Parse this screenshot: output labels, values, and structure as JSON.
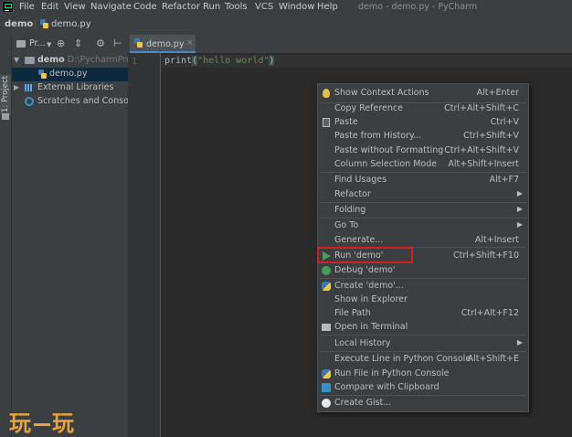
{
  "menubar": {
    "items": [
      "File",
      "Edit",
      "View",
      "Navigate",
      "Code",
      "Refactor",
      "Run",
      "Tools",
      "VCS",
      "Window",
      "Help"
    ],
    "title": "demo - demo.py - PyCharm"
  },
  "navbar": {
    "root": "demo",
    "file": "demo.py"
  },
  "tool_window_strip": {
    "label": "1: Project"
  },
  "project_panel": {
    "header_label": "Pr...",
    "tree": {
      "root_name": "demo",
      "root_path": "D:\\PycharmProje",
      "file": "demo.py",
      "external_libraries": "External Libraries",
      "scratches": "Scratches and Consoles"
    }
  },
  "editor": {
    "tab_label": "demo.py",
    "line_number": "1",
    "code": {
      "fn": "print",
      "open": "(",
      "string": "\"hello world\"",
      "close": ")"
    }
  },
  "context_menu": {
    "items": [
      {
        "label": "Show Context Actions",
        "shortcut": "Alt+Enter",
        "icon": "bulb-icon"
      },
      {
        "label": "Copy Reference",
        "shortcut": "Ctrl+Alt+Shift+C"
      },
      {
        "label": "Paste",
        "shortcut": "Ctrl+V",
        "icon": "clipboard-icon"
      },
      {
        "label": "Paste from History...",
        "shortcut": "Ctrl+Shift+V"
      },
      {
        "label": "Paste without Formatting",
        "shortcut": "Ctrl+Alt+Shift+V"
      },
      {
        "label": "Column Selection Mode",
        "shortcut": "Alt+Shift+Insert"
      },
      {
        "label": "Find Usages",
        "shortcut": "Alt+F7"
      },
      {
        "label": "Refactor",
        "submenu": true
      },
      {
        "label": "Folding",
        "submenu": true
      },
      {
        "label": "Go To",
        "submenu": true
      },
      {
        "label": "Generate...",
        "shortcut": "Alt+Insert"
      },
      {
        "label": "Run 'demo'",
        "shortcut": "Ctrl+Shift+F10",
        "icon": "run-icon",
        "highlighted": true
      },
      {
        "label": "Debug 'demo'",
        "icon": "debug-icon"
      },
      {
        "label": "Create 'demo'...",
        "icon": "python-icon"
      },
      {
        "label": "Show in Explorer"
      },
      {
        "label": "File Path",
        "shortcut": "Ctrl+Alt+F12"
      },
      {
        "label": "Open in Terminal",
        "icon": "terminal-icon"
      },
      {
        "label": "Local History",
        "submenu": true
      },
      {
        "label": "Execute Line in Python Console",
        "shortcut": "Alt+Shift+E"
      },
      {
        "label": "Run File in Python Console",
        "icon": "python-icon"
      },
      {
        "label": "Compare with Clipboard",
        "icon": "compare-icon"
      },
      {
        "label": "Create Gist...",
        "icon": "github-icon"
      }
    ]
  },
  "watermark": {
    "left": "玩",
    "right": "玩"
  },
  "colors": {
    "highlight_box": "#d21f1f",
    "accent": "#4a88c7",
    "run_green": "#499c54"
  }
}
